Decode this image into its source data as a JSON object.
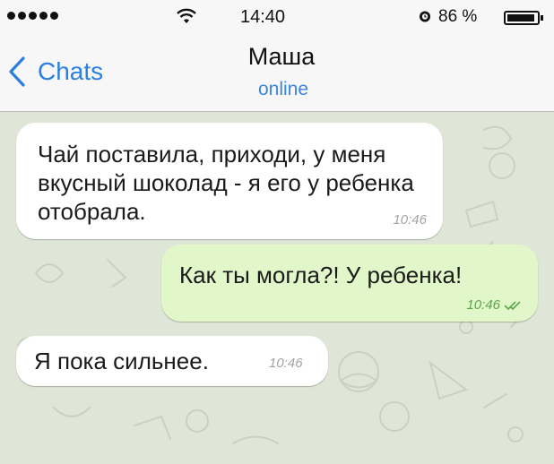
{
  "status_bar": {
    "time": "14:40",
    "battery_percent": "86 %",
    "signal_bars": 5,
    "icons": [
      "signal-icon",
      "wifi-icon",
      "alarm-icon",
      "battery-icon"
    ]
  },
  "header": {
    "back_label": "Chats",
    "contact_name": "Маша",
    "contact_status": "online",
    "accent_color": "#2a7fe3"
  },
  "messages": [
    {
      "direction": "incoming",
      "text": "Чай поставила, приходи, у меня вкусный шоколад - я его у ребенка отобрала.",
      "time": "10:46"
    },
    {
      "direction": "outgoing",
      "text": "Как ты могла?! У ребенка!",
      "time": "10:46",
      "read_icon": "double-check-icon"
    },
    {
      "direction": "incoming",
      "text": "Я пока сильнее.",
      "time": "10:46"
    }
  ],
  "colors": {
    "chat_background": "#dfe6d7",
    "incoming_bubble": "#ffffff",
    "outgoing_bubble": "#e1f7c9",
    "outgoing_meta": "#5fa44a"
  }
}
